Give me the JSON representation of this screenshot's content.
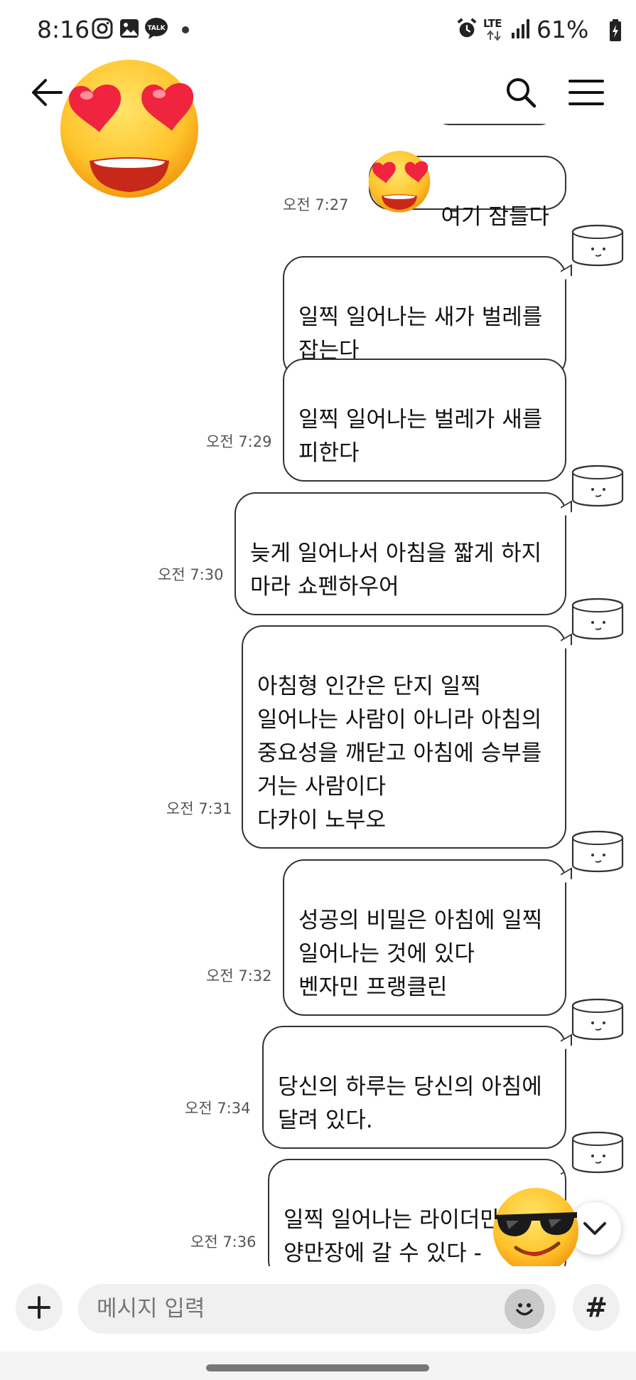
{
  "status_bar": {
    "time": "8:16",
    "network": "LTE",
    "battery": "61%",
    "icons": [
      "instagram-icon",
      "gallery-icon",
      "kakaotalk-icon",
      "alarm-icon",
      "signal-icon",
      "battery-icon"
    ],
    "talk_badge": "TALK"
  },
  "header": {
    "back_icon": "arrow-left-icon",
    "search_icon": "search-icon",
    "menu_icon": "hamburger-menu-icon"
  },
  "messages": [
    {
      "text": "여기 잠들다",
      "time": "오전 7:27",
      "avatar": false
    },
    {
      "text": "일찍 일어나는 새가 벌레를\n잡는다",
      "time": "",
      "avatar": true
    },
    {
      "text": "일찍 일어나는 벌레가 새를\n피한다",
      "time": "오전 7:29",
      "avatar": false
    },
    {
      "text": "늦게 일어나서 아침을 짧게 하지\n마라 쇼펜하우어",
      "time": "오전 7:30",
      "avatar": true
    },
    {
      "text": "아침형 인간은 단지 일찍\n일어나는 사람이 아니라 아침의\n중요성을 깨닫고 아침에 승부를\n거는 사람이다\n다카이 노부오",
      "time": "오전 7:31",
      "avatar": true
    },
    {
      "text": "성공의 비밀은 아침에 일찍\n일어나는 것에 있다\n벤자민 프랭클린",
      "time": "오전 7:32",
      "avatar": true
    },
    {
      "text": "당신의 하루는 당신의 아침에\n달려 있다.",
      "time": "오전 7:34",
      "avatar": true
    },
    {
      "text": "일찍 일어나는 라이더만\n양만장에 갈 수 있다 - ",
      "time": "오전 7:36",
      "avatar": true
    }
  ],
  "composer": {
    "placeholder": "메시지 입력",
    "hash_label": "#"
  },
  "colors": {
    "bubble_border": "#333333",
    "input_bg": "#f0f0f0",
    "emoji_yellow": "#ffc83d"
  },
  "stickers": [
    "heart-eyes-emoji",
    "heart-eyes-emoji-small",
    "sunglasses-emoji"
  ]
}
